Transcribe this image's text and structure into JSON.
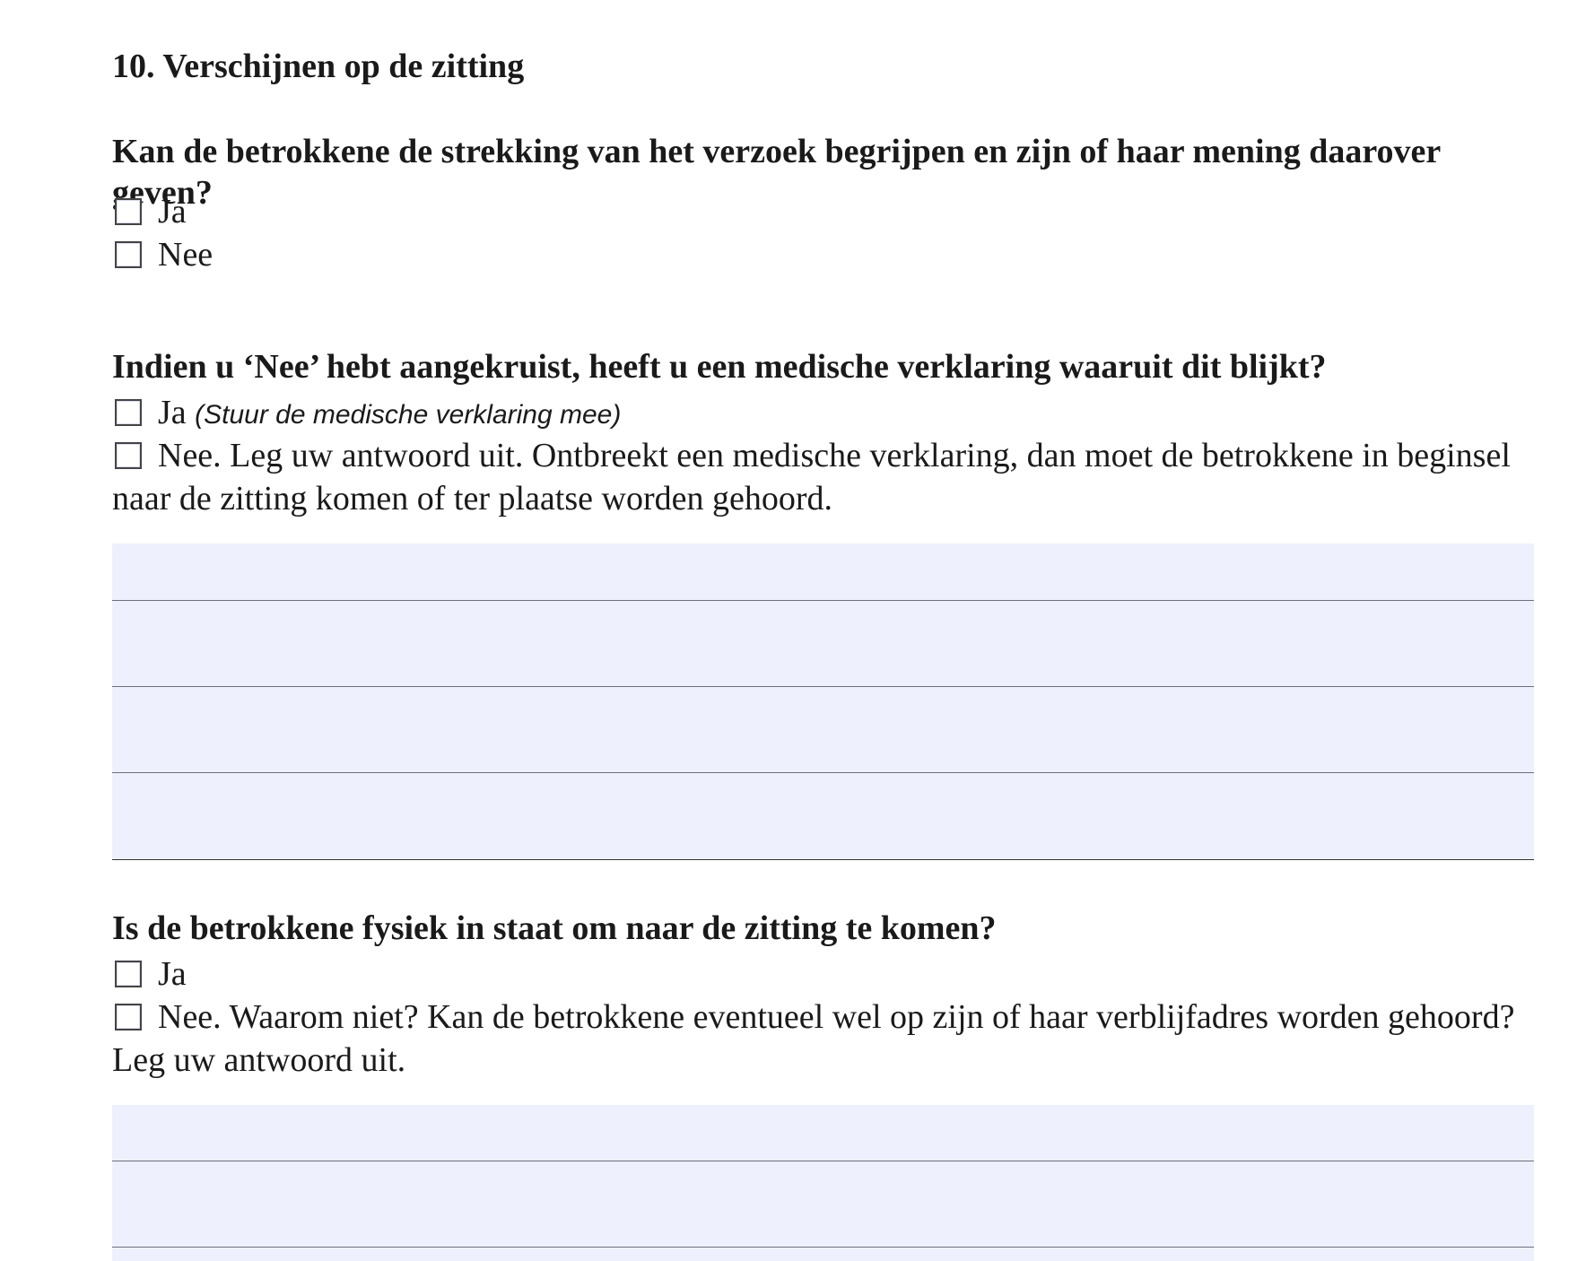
{
  "section": {
    "title": "10. Verschijnen op de zitting"
  },
  "q1": {
    "text": "Kan de betrokkene de strekking van het verzoek begrijpen en zijn of haar mening daarover geven?",
    "options": [
      {
        "label": "Ja",
        "checked": false
      },
      {
        "label": "Nee",
        "checked": false
      }
    ]
  },
  "q2": {
    "text": "Indien u ‘Nee’ hebt aangekruist, heeft u een medische verklaring waaruit dit blijkt?",
    "options": [
      {
        "label": "Ja",
        "hint": "(Stuur de medische verklaring mee)",
        "checked": false
      },
      {
        "label": "Nee. Leg uw antwoord uit. Ontbreekt een medische verklaring, dan moet de betrokkene in beginsel naar de zitting komen of ter plaatse worden gehoord.",
        "checked": false
      }
    ],
    "answer": ""
  },
  "q3": {
    "text": "Is de betrokkene fysiek in staat om naar de zitting te komen?",
    "options": [
      {
        "label": "Ja",
        "checked": false
      },
      {
        "label": "Nee. Waarom niet? Kan de betrokkene eventueel wel op zijn of haar verblijfadres worden gehoord? Leg uw antwoord uit.",
        "checked": false
      }
    ],
    "answer": ""
  },
  "colors": {
    "field_background": "#eef1fd",
    "line": "#6c6f7c",
    "text": "#1a1a1a"
  }
}
